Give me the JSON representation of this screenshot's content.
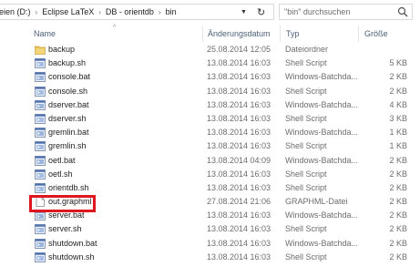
{
  "address": {
    "breadcrumbs": [
      "eien (D:)",
      "Eclipse LaTeX",
      "DB - orientdb",
      "bin"
    ]
  },
  "search": {
    "placeholder": "\"bin\" durchsuchen"
  },
  "columns": {
    "name": "Name",
    "date": "Änderungsdatum",
    "type": "Typ",
    "size": "Größe"
  },
  "files": [
    {
      "name": "backup",
      "date": "25.08.2014 12:05",
      "type": "Dateiordner",
      "size": "",
      "icon": "folder-icon"
    },
    {
      "name": "backup.sh",
      "date": "13.08.2014 16:03",
      "type": "Shell Script",
      "size": "5 KB",
      "icon": "script-file-icon"
    },
    {
      "name": "console.bat",
      "date": "13.08.2014 16:03",
      "type": "Windows-Batchda...",
      "size": "2 KB",
      "icon": "batch-file-icon"
    },
    {
      "name": "console.sh",
      "date": "13.08.2014 16:03",
      "type": "Shell Script",
      "size": "2 KB",
      "icon": "script-file-icon"
    },
    {
      "name": "dserver.bat",
      "date": "13.08.2014 16:03",
      "type": "Windows-Batchda...",
      "size": "4 KB",
      "icon": "batch-file-icon"
    },
    {
      "name": "dserver.sh",
      "date": "13.08.2014 16:03",
      "type": "Shell Script",
      "size": "3 KB",
      "icon": "script-file-icon"
    },
    {
      "name": "gremlin.bat",
      "date": "13.08.2014 16:03",
      "type": "Windows-Batchda...",
      "size": "1 KB",
      "icon": "batch-file-icon"
    },
    {
      "name": "gremlin.sh",
      "date": "13.08.2014 16:03",
      "type": "Shell Script",
      "size": "1 KB",
      "icon": "script-file-icon"
    },
    {
      "name": "oetl.bat",
      "date": "13.08.2014 04:09",
      "type": "Windows-Batchda...",
      "size": "2 KB",
      "icon": "batch-file-icon"
    },
    {
      "name": "oetl.sh",
      "date": "13.08.2014 16:03",
      "type": "Shell Script",
      "size": "2 KB",
      "icon": "script-file-icon"
    },
    {
      "name": "orientdb.sh",
      "date": "13.08.2014 16:03",
      "type": "Shell Script",
      "size": "2 KB",
      "icon": "script-file-icon"
    },
    {
      "name": "out.graphml",
      "date": "27.08.2014 21:06",
      "type": "GRAPHML-Datei",
      "size": "2 KB",
      "icon": "document-file-icon"
    },
    {
      "name": "server.bat",
      "date": "13.08.2014 16:03",
      "type": "Windows-Batchda...",
      "size": "2 KB",
      "icon": "batch-file-icon"
    },
    {
      "name": "server.sh",
      "date": "13.08.2014 16:03",
      "type": "Shell Script",
      "size": "2 KB",
      "icon": "script-file-icon"
    },
    {
      "name": "shutdown.bat",
      "date": "13.08.2014 16:03",
      "type": "Windows-Batchda...",
      "size": "2 KB",
      "icon": "batch-file-icon"
    },
    {
      "name": "shutdown.sh",
      "date": "13.08.2014 16:03",
      "type": "Shell Script",
      "size": "2 KB",
      "icon": "script-file-icon"
    }
  ],
  "highlight_color": "#e0161f"
}
